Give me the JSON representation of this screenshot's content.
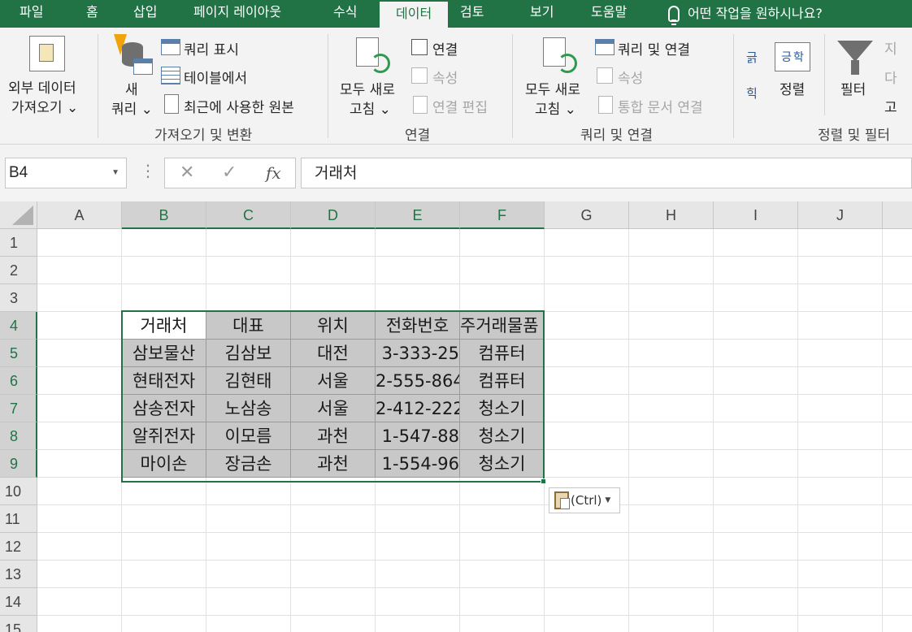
{
  "menu": {
    "tabs": [
      "파일",
      "홈",
      "삽입",
      "페이지 레이아웃",
      "수식",
      "데이터",
      "검토",
      "보기",
      "도움말"
    ],
    "active_tab": "데이터",
    "tell_me": "어떤 작업을 원하시나요?"
  },
  "ribbon": {
    "get_external": {
      "line1": "외부 데이터",
      "line2": "가져오기 ⌄"
    },
    "new_query": {
      "line1": "새",
      "line2": "쿼리 ⌄"
    },
    "show_queries": "쿼리 표시",
    "from_table": "테이블에서",
    "recent_sources": "최근에 사용한 원본",
    "group_get_transform": "가져오기 및 변환",
    "refresh_all_1": {
      "line1": "모두 새로",
      "line2": "고침 ⌄"
    },
    "connections": "연결",
    "properties_1": "속성",
    "edit_links": "연결 편집",
    "group_connections": "연결",
    "refresh_all_2": {
      "line1": "모두 새로",
      "line2": "고침 ⌄"
    },
    "queries_connections": "쿼리 및 연결",
    "properties_2": "속성",
    "workbook_links": "통합 문서 연결",
    "group_queries": "쿼리 및 연결",
    "sort": "정렬",
    "filter": "필터",
    "group_sort_filter": "정렬 및 필터",
    "sort_az_top": "긁",
    "sort_az_bottom": "힉",
    "sort_icon_left": "긍",
    "sort_icon_right": "학",
    "clear_stub": "지",
    "reapply_stub": "다",
    "advanced_stub": "고"
  },
  "formula_bar": {
    "name_box": "B4",
    "cancel": "✕",
    "enter": "✓",
    "fx": "fx",
    "value": "거래처"
  },
  "grid": {
    "columns": [
      "A",
      "B",
      "C",
      "D",
      "E",
      "F",
      "G",
      "H",
      "I",
      "J"
    ],
    "rows": [
      "1",
      "2",
      "3",
      "4",
      "5",
      "6",
      "7",
      "8",
      "9",
      "10",
      "11",
      "12",
      "13",
      "14",
      "15"
    ],
    "table": {
      "headers": [
        "거래처",
        "대표",
        "위치",
        "전화번호",
        "주거래물품"
      ],
      "rows": [
        [
          "삼보물산",
          "김삼보",
          "대전",
          "3-333-25",
          "컴퓨터"
        ],
        [
          "현태전자",
          "김현태",
          "서울",
          "2-555-864",
          "컴퓨터"
        ],
        [
          "삼송전자",
          "노삼송",
          "서울",
          "2-412-222",
          "청소기"
        ],
        [
          "알쥐전자",
          "이모름",
          "과천",
          "1-547-88",
          "청소기"
        ],
        [
          "마이손",
          "장금손",
          "과천",
          "1-554-96",
          "청소기"
        ]
      ]
    }
  },
  "paste_options": {
    "label": "(Ctrl)"
  }
}
